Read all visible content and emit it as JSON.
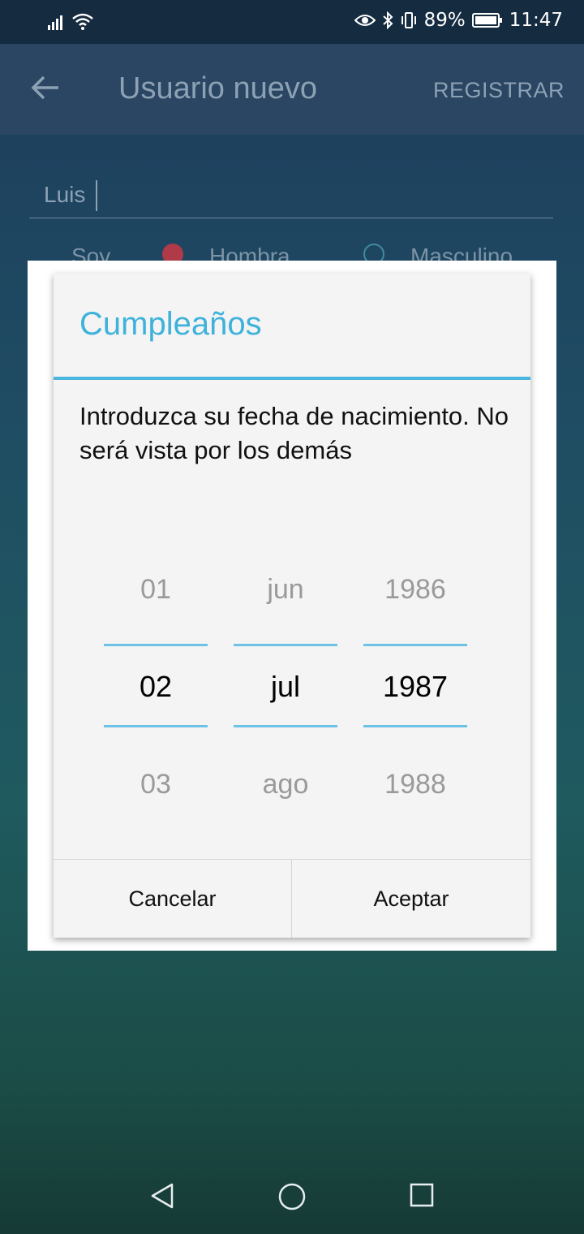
{
  "status_bar": {
    "battery": "89%",
    "time": "11:47",
    "icons": [
      "signal-icon",
      "wifi-icon",
      "eye-icon",
      "bluetooth-icon",
      "vibrate-icon",
      "battery-icon"
    ]
  },
  "app_bar": {
    "title": "Usuario nuevo",
    "action": "REGISTRAR",
    "back_icon": "arrow-left-icon"
  },
  "form": {
    "name_value": "Luis",
    "gender_label": "Soy",
    "option_female": "Hombra",
    "option_male": "Masculino"
  },
  "dialog": {
    "title": "Cumpleaños",
    "message": "Introduzca su fecha de nacimiento. No será vista por los demás",
    "day": {
      "prev": "01",
      "current": "02",
      "next": "03"
    },
    "month": {
      "prev": "jun",
      "current": "jul",
      "next": "ago"
    },
    "year": {
      "prev": "1986",
      "current": "1987",
      "next": "1988"
    },
    "cancel_label": "Cancelar",
    "accept_label": "Aceptar"
  },
  "colors": {
    "accent": "#3fb2db",
    "picker_line": "#6cc3e6",
    "app_bar": "#2a4663",
    "status_bar": "#152b40"
  }
}
